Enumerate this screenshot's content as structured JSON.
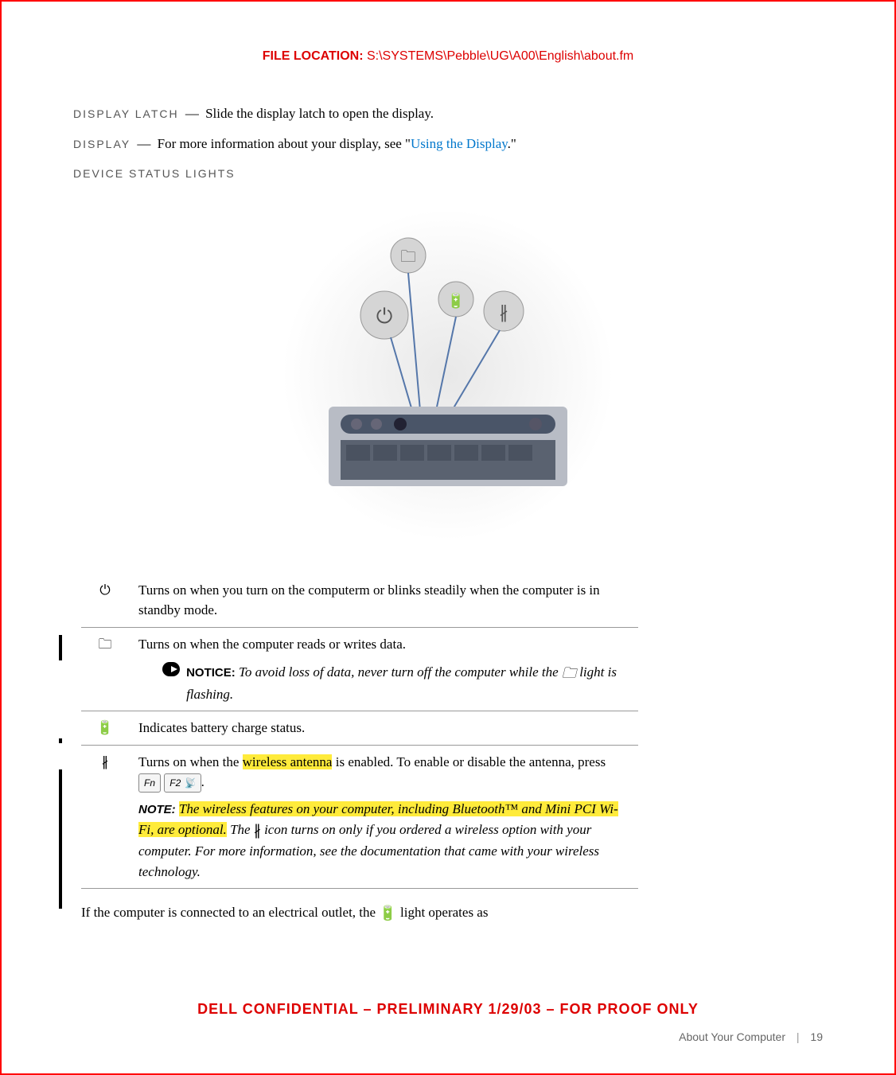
{
  "header": {
    "file_location_label": "FILE LOCATION:",
    "file_location_path": "S:\\SYSTEMS\\Pebble\\UG\\A00\\English\\about.fm"
  },
  "definitions": {
    "display_latch": {
      "term": "DISPLAY LATCH",
      "text": "Slide the display latch to open the display."
    },
    "display": {
      "term": "DISPLAY",
      "text_before": "For more information about your display, see \"",
      "link": "Using the Display",
      "text_after": ".\""
    },
    "device_status_lights": {
      "term": "DEVICE STATUS LIGHTS"
    }
  },
  "status_rows": {
    "power": {
      "icon": "⏻",
      "text": "Turns on when you turn on the computerm or blinks steadily when the computer is in standby mode."
    },
    "drive": {
      "icon": "🗀",
      "text": "Turns on when the computer reads or writes data.",
      "notice_label": "NOTICE:",
      "notice_text_before": "To avoid loss of data, never turn off the computer while the ",
      "notice_icon": "🗀",
      "notice_text_after": " light is flashing."
    },
    "battery": {
      "icon": "🔋",
      "text": "Indicates battery charge status."
    },
    "wireless": {
      "icon": "⚊",
      "bluetooth_glyph": "∦",
      "text_before": "Turns on when the ",
      "highlight1": "wireless antenna",
      "text_mid1": " is enabled. To enable or disable the antenna, press ",
      "key1": "Fn",
      "key2_prefix": "F2",
      "key2_glyph": "📡",
      "text_mid2": ".",
      "note_label": "NOTE:",
      "note_hl_before": "The wireless features on your computer, including Bluetooth™ and Mini PCI Wi-Fi, are optional.",
      "note_mid1": " The ",
      "note_icon_glyph": "∦",
      "note_after": " icon turns on only if you ordered a wireless option with your computer. For more information, see the documentation that came with your wireless technology."
    }
  },
  "bottom_text": {
    "before": "If the computer is connected to an electrical outlet, the ",
    "icon": "🔋",
    "after": " light operates as"
  },
  "confidential": "DELL CONFIDENTIAL – PRELIMINARY 1/29/03 – FOR PROOF ONLY",
  "footer": {
    "section": "About Your Computer",
    "page": "19"
  }
}
